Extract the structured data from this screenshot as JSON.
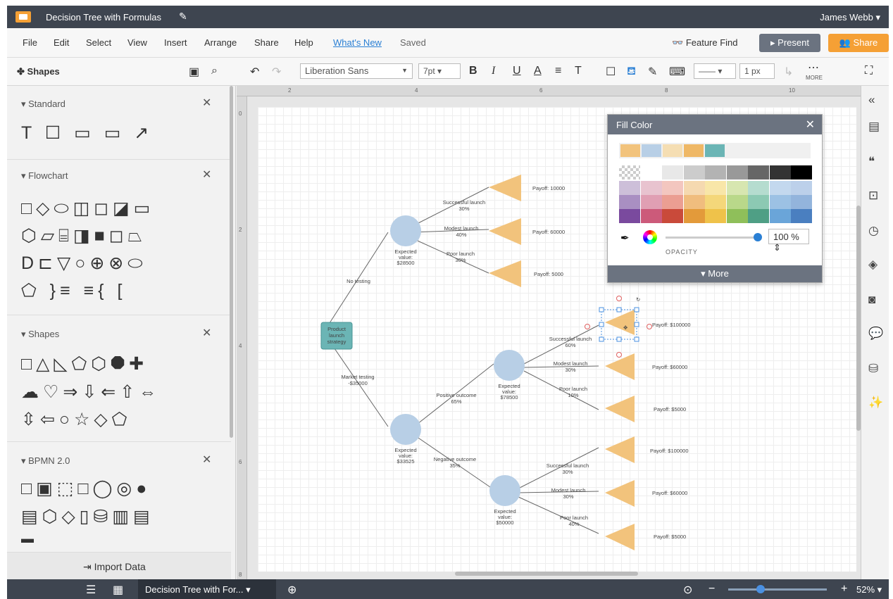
{
  "titlebar": {
    "doc_title": "Decision Tree with Formulas",
    "user": "James Webb ▾"
  },
  "menu": {
    "items": [
      "File",
      "Edit",
      "Select",
      "View",
      "Insert",
      "Arrange",
      "Share",
      "Help"
    ],
    "whats_new": "What's New",
    "saved": "Saved",
    "feature_find": "Feature Find",
    "present": "▸ Present",
    "share": "Share"
  },
  "toolbar": {
    "shapes_label": "Shapes",
    "font_family": "Liberation Sans",
    "font_size": "7pt",
    "line_style": "——",
    "line_width": "1 px",
    "more_label": "MORE"
  },
  "leftpanel": {
    "sections": [
      {
        "title": "▾ Standard",
        "rows": [
          "T ☐ ▭ ▭ ↗"
        ]
      },
      {
        "title": "▾ Flowchart",
        "rows": [
          "□◇⬭◫◻◪▭",
          "⬡▱⌸◨■◻⏢",
          "D⊏▽○⊕⊗⬭",
          "⬠ }≡ ≡{ ["
        ]
      },
      {
        "title": "▾ Shapes",
        "rows": [
          "□△◺⬠⬡⯃✚",
          "☁♡⇒⇩⇐⇧⇔",
          "⇳⇦○☆◇⬠"
        ]
      },
      {
        "title": "▾ BPMN 2.0",
        "rows": [
          "□▣⬚□◯◎●",
          "▤⬡◇▯⛁▥▤",
          "▬"
        ]
      }
    ],
    "import_label": "Import Data"
  },
  "ruler": {
    "top": [
      "2",
      "4",
      "6",
      "8",
      "10"
    ],
    "left": [
      "0",
      "2",
      "4",
      "6",
      "8"
    ]
  },
  "diagram": {
    "root": "Product launch strategy",
    "branch_no_testing": "No testing",
    "branch_market_testing": [
      "Market testing",
      "-$35000"
    ],
    "ev_no_testing": [
      "Expected",
      "value:",
      "$28500"
    ],
    "ev_market": [
      "Expected",
      "value:",
      "$33525"
    ],
    "ev_positive": [
      "Expected",
      "value:",
      "$78500"
    ],
    "ev_negative": [
      "Expected",
      "value:",
      "$50000"
    ],
    "positive_outcome": [
      "Positive outcome",
      "65%"
    ],
    "negative_outcome": [
      "Negative outcome",
      "35%"
    ],
    "nt_success": [
      "Successful launch",
      "30%"
    ],
    "nt_modest": [
      "Modest launch",
      "40%"
    ],
    "nt_poor": [
      "Poor launch",
      "30%"
    ],
    "nt_payoffs": [
      "Payoff: 10000",
      "Payoff: 60000",
      "Payoff: 5000"
    ],
    "pos_success": [
      "Successful launch",
      "60%"
    ],
    "pos_modest": [
      "Modest launch",
      "30%"
    ],
    "pos_poor": [
      "Poor launch",
      "10%"
    ],
    "pos_payoffs": [
      "Payoff: $100000",
      "Payoff: $60000",
      "Payoff: $5000"
    ],
    "neg_success": [
      "Successful launch",
      "30%"
    ],
    "neg_modest": [
      "Modest launch",
      "30%"
    ],
    "neg_poor": [
      "Poor launch",
      "40%"
    ],
    "neg_payoffs": [
      "Payoff: $100000",
      "Payoff: $60000",
      "Payoff: $5000"
    ]
  },
  "fill_popup": {
    "title": "Fill Color",
    "recent": [
      "#f2c37c",
      "#b8cfe6",
      "#f5deb3",
      "#efb866",
      "#6bb5b5"
    ],
    "grays": [
      "checker",
      "#ffffff",
      "#e8e8e8",
      "#cccccc",
      "#b3b3b3",
      "#999999",
      "#666666",
      "#333333",
      "#000000"
    ],
    "palette": [
      [
        "#cdbfd9",
        "#e8c3cf",
        "#f3c6bf",
        "#f5d9b0",
        "#f8e6a8",
        "#d7e6b0",
        "#b5dccf",
        "#c3d8ee",
        "#bcd0ea"
      ],
      [
        "#a98fc2",
        "#e09fb3",
        "#eb9e92",
        "#f0bd7e",
        "#f4d77a",
        "#b9d88a",
        "#8cc9b3",
        "#9cc1e4",
        "#93b4dc"
      ],
      [
        "#7a4a9e",
        "#cc5a7a",
        "#c94a3a",
        "#e39a3a",
        "#efc24a",
        "#8fbf5a",
        "#4f9f85",
        "#6aa5d9",
        "#4a7fc0"
      ]
    ],
    "opacity_value": "100 %",
    "opacity_label": "OPACITY",
    "more": "▾ More"
  },
  "bottombar": {
    "page_tab": "Decision Tree with For...",
    "zoom": "52% ▾"
  },
  "colors": {
    "accent": "#f5a035",
    "chrome": "#3e4550",
    "triangle": "#f2c37c",
    "chance_node": "#b8cfe6",
    "root_node": "#6bb5b5"
  }
}
